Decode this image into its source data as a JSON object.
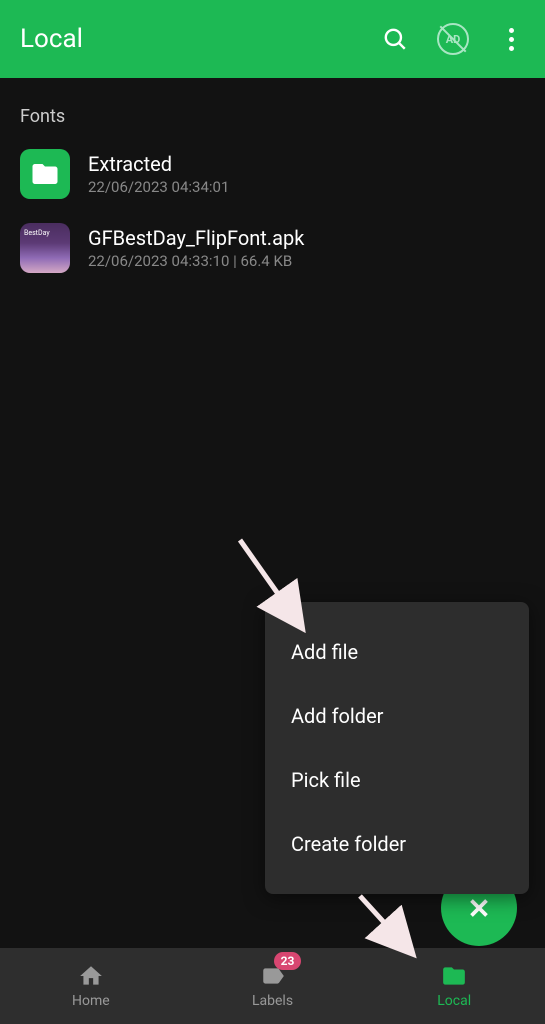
{
  "header": {
    "title": "Local",
    "ad_label": "AD"
  },
  "breadcrumb": "Fonts",
  "files": [
    {
      "name": "Extracted",
      "meta": "22/06/2023 04:34:01",
      "type": "folder"
    },
    {
      "name": "GFBestDay_FlipFont.apk",
      "meta": "22/06/2023 04:33:10 | 66.4 KB",
      "type": "apk",
      "apk_tag": "BestDay"
    }
  ],
  "popup": {
    "items": [
      "Add file",
      "Add folder",
      "Pick file",
      "Create folder"
    ]
  },
  "nav": {
    "home": "Home",
    "labels": "Labels",
    "local": "Local",
    "badge": "23"
  }
}
